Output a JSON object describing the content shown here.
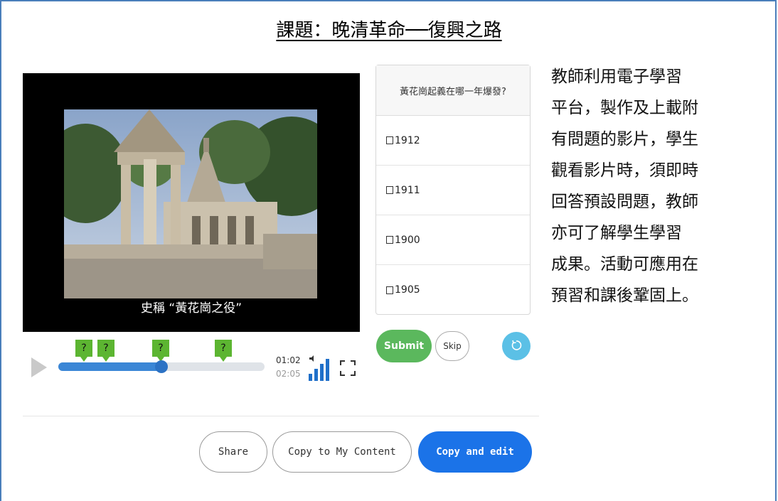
{
  "title": "課題：晚清革命──復興之路",
  "video": {
    "subtitle": "史稱 “黃花崗之役”",
    "current_time": "01:02",
    "total_time": "02:05",
    "progress": 0.5,
    "marker_label": "?",
    "marker_count": 4
  },
  "question": {
    "prompt": "黃花崗起義在哪一年爆發?",
    "options": [
      "1912",
      "1911",
      "1900",
      "1905"
    ],
    "submit_label": "Submit",
    "skip_label": "Skip"
  },
  "side_text": {
    "lines": [
      "教師利用電子學習",
      "平台，製作及上載附",
      "有問題的影片，學生",
      "觀看影片時，須即時",
      "回答預設問題，教師",
      "亦可了解學生學習",
      "成果。活動可應用在",
      "預習和課後鞏固上。"
    ]
  },
  "actions": {
    "share_label": "Share",
    "copy_label": "Copy to My Content",
    "edit_label": "Copy and edit"
  },
  "colors": {
    "accent_blue": "#1b73e8",
    "submit_green": "#5bb85d",
    "marker_green": "#5cb531",
    "progress_blue": "#3a86d6",
    "retry_cyan": "#5bc0e6",
    "frame_blue": "#4a7ebb"
  },
  "icons": {
    "play": "play-icon",
    "volume": "volume-icon",
    "fullscreen": "fullscreen-icon",
    "retry": "retry-icon"
  }
}
